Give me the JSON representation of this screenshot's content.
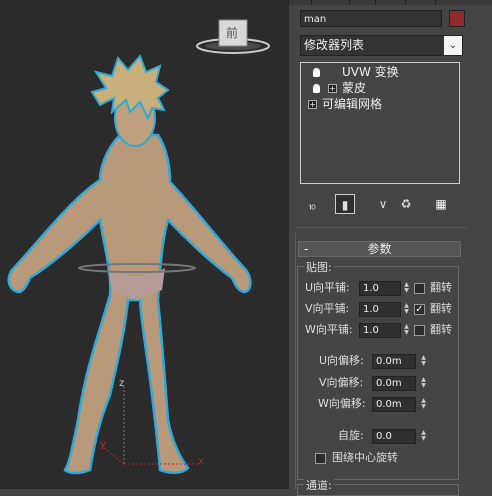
{
  "viewport": {
    "viewcube_label": "前",
    "axis_z": "z",
    "axis_x": "x",
    "axis_y": "y"
  },
  "panel": {
    "object_name": "man",
    "object_color": "#8e2a2a",
    "modifier_list": "修改器列表",
    "stack": [
      {
        "label": "UVW 变换",
        "has_bulb": true,
        "has_plus": false,
        "selected": false
      },
      {
        "label": "蒙皮",
        "has_bulb": true,
        "has_plus": true,
        "selected": false
      },
      {
        "label": "可编辑网格",
        "has_bulb": false,
        "has_plus": true,
        "selected": false
      }
    ],
    "toolbar_icons": [
      "pin-stack-icon",
      "show-end-result-icon",
      "make-unique-icon",
      "remove-modifier-icon",
      "configure-modifier-sets-icon"
    ],
    "rollout": {
      "collapse_glyph": "-",
      "title": "参数",
      "tiling_group": "贴图:",
      "u_tile_label": "U向平铺:",
      "u_tile_value": "1.0",
      "u_flip_label": "翻转",
      "u_flip_checked": false,
      "v_tile_label": "V向平铺:",
      "v_tile_value": "1.0",
      "v_flip_label": "翻转",
      "v_flip_checked": true,
      "w_tile_label": "W向平铺:",
      "w_tile_value": "1.0",
      "w_flip_label": "翻转",
      "w_flip_checked": false,
      "u_offset_label": "U向偏移:",
      "u_offset_value": "0.0m",
      "v_offset_label": "V向偏移:",
      "v_offset_value": "0.0m",
      "w_offset_label": "W向偏移:",
      "w_offset_value": "0.0m",
      "rotate_label": "自旋:",
      "rotate_value": "0.0",
      "around_center_label": "围绕中心旋转",
      "around_center_checked": false,
      "channel_group": "通道:"
    }
  }
}
